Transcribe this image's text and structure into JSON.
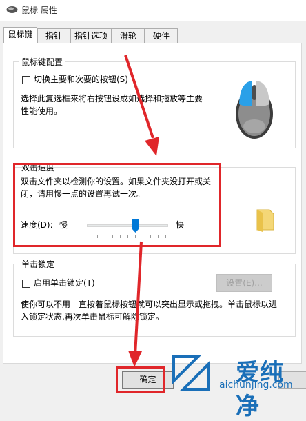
{
  "window": {
    "title": "鼠标 属性"
  },
  "tabs": [
    {
      "label": "鼠标键"
    },
    {
      "label": "指针"
    },
    {
      "label": "指针选项"
    },
    {
      "label": "滑轮"
    },
    {
      "label": "硬件"
    }
  ],
  "button_config": {
    "group_title": "鼠标键配置",
    "switch_checkbox_label": "切换主要和次要的按钮(S)",
    "switch_checked": false,
    "description_line1": "选择此复选框来将右按钮设成如选择和拖放等主要",
    "description_line2": "性能使用。"
  },
  "double_click": {
    "group_title": "双击速度",
    "description_line1": "双击文件夹以检测你的设置。如果文件夹没打开或关",
    "description_line2": "闭，请用慢一点的设置再试一次。",
    "speed_label": "速度(D):",
    "slow_label": "慢",
    "fast_label": "快",
    "speed_level_fraction": 0.6
  },
  "click_lock": {
    "group_title": "单击锁定",
    "enable_checkbox_label": "启用单击锁定(T)",
    "enable_checked": false,
    "settings_button_label": "设置(E)...",
    "description_line1": "使你可以不用一直按着鼠标按钮就可以突出显示或拖拽。单击鼠标以进",
    "description_line2": "入锁定状态,再次单击鼠标可解除锁定。"
  },
  "footer": {
    "ok_label": "确定"
  },
  "watermark": {
    "brand_cn": "爱纯净",
    "brand_en": "aichunjing.com"
  },
  "colors": {
    "highlight": "#e0262a",
    "mouse_blue": "#2aa0e8",
    "watermark_blue": "#1a6fb8"
  }
}
